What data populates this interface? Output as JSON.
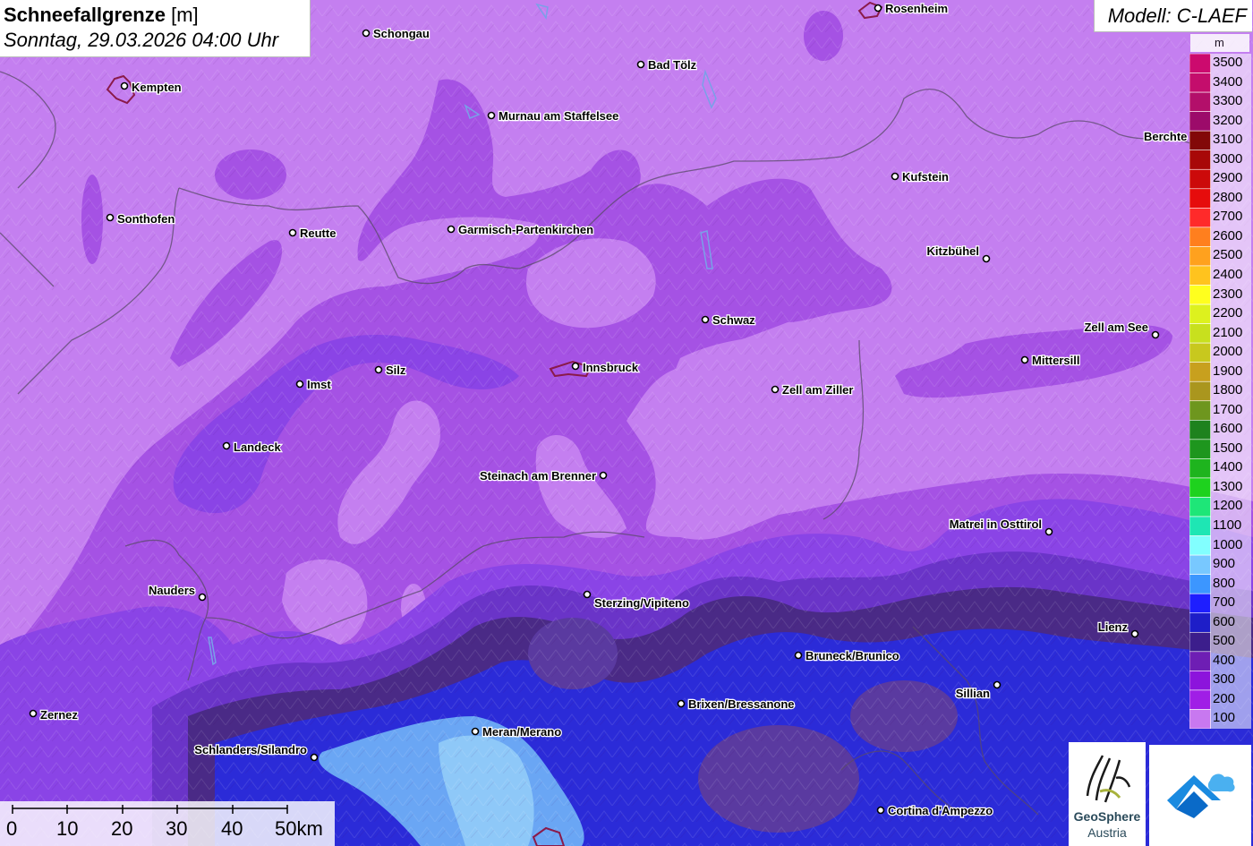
{
  "header": {
    "title_bold": "Schneefallgrenze",
    "title_unit": "[m]",
    "datetime": "Sonntag, 29.03.2026 04:00 Uhr"
  },
  "model": {
    "label": "Modell: C-LAEF"
  },
  "legend": {
    "unit": "m",
    "levels": [
      {
        "label": "3500",
        "color": "#cc0a6e"
      },
      {
        "label": "3400",
        "color": "#c40d6c"
      },
      {
        "label": "3300",
        "color": "#b30f6a"
      },
      {
        "label": "3200",
        "color": "#9c0b6a"
      },
      {
        "label": "3100",
        "color": "#820808"
      },
      {
        "label": "3000",
        "color": "#a80808"
      },
      {
        "label": "2900",
        "color": "#cc0a0a"
      },
      {
        "label": "2800",
        "color": "#e60c0c"
      },
      {
        "label": "2700",
        "color": "#ff2a2a"
      },
      {
        "label": "2600",
        "color": "#ff7f1e"
      },
      {
        "label": "2500",
        "color": "#ffa11e"
      },
      {
        "label": "2400",
        "color": "#ffc31e"
      },
      {
        "label": "2300",
        "color": "#ffff1e"
      },
      {
        "label": "2200",
        "color": "#ddf11e"
      },
      {
        "label": "2100",
        "color": "#c8e01e"
      },
      {
        "label": "2000",
        "color": "#c8c81e"
      },
      {
        "label": "1900",
        "color": "#c8a01e"
      },
      {
        "label": "1800",
        "color": "#aa961e"
      },
      {
        "label": "1700",
        "color": "#6e961e"
      },
      {
        "label": "1600",
        "color": "#1e821e"
      },
      {
        "label": "1500",
        "color": "#1e961e"
      },
      {
        "label": "1400",
        "color": "#1eb41e"
      },
      {
        "label": "1300",
        "color": "#1ed21e"
      },
      {
        "label": "1200",
        "color": "#1ee678"
      },
      {
        "label": "1100",
        "color": "#1ee6b4"
      },
      {
        "label": "1000",
        "color": "#82ffff"
      },
      {
        "label": "900",
        "color": "#78c8ff"
      },
      {
        "label": "800",
        "color": "#3c96ff"
      },
      {
        "label": "700",
        "color": "#1e1eff"
      },
      {
        "label": "600",
        "color": "#1e1ec8"
      },
      {
        "label": "500",
        "color": "#3c1e8c"
      },
      {
        "label": "400",
        "color": "#6e1eb4"
      },
      {
        "label": "300",
        "color": "#8c14dc"
      },
      {
        "label": "200",
        "color": "#a01ee6"
      },
      {
        "label": "100",
        "color": "#c878f0"
      }
    ]
  },
  "scale_bar": {
    "labels": [
      "0",
      "10",
      "20",
      "30",
      "40",
      "50km"
    ]
  },
  "cities": [
    {
      "name": "Rosenheim"
    },
    {
      "name": "Schongau"
    },
    {
      "name": "Bad Tölz"
    },
    {
      "name": "Kempten"
    },
    {
      "name": "Murnau am Staffelsee"
    },
    {
      "name": "Berchte"
    },
    {
      "name": "Kufstein"
    },
    {
      "name": "Sonthofen"
    },
    {
      "name": "Reutte"
    },
    {
      "name": "Garmisch-Partenkirchen"
    },
    {
      "name": "Kitzbühel"
    },
    {
      "name": "Schwaz"
    },
    {
      "name": "Zell am See"
    },
    {
      "name": "Mittersill"
    },
    {
      "name": "Silz"
    },
    {
      "name": "Innsbruck"
    },
    {
      "name": "Imst"
    },
    {
      "name": "Zell am Ziller"
    },
    {
      "name": "Landeck"
    },
    {
      "name": "Steinach am Brenner"
    },
    {
      "name": "Matrei in Osttirol"
    },
    {
      "name": "Nauders"
    },
    {
      "name": "Sterzing/Vipiteno"
    },
    {
      "name": "Lienz"
    },
    {
      "name": "Bruneck/Brunico"
    },
    {
      "name": "Sillian"
    },
    {
      "name": "Brixen/Bressanone"
    },
    {
      "name": "Zernez"
    },
    {
      "name": "Meran/Merano"
    },
    {
      "name": "Schlanders/Silandro"
    },
    {
      "name": "Cortina d'Ampezzo"
    }
  ],
  "logos": {
    "geosphere_line1": "GeoSphere",
    "geosphere_line2": "Austria"
  }
}
